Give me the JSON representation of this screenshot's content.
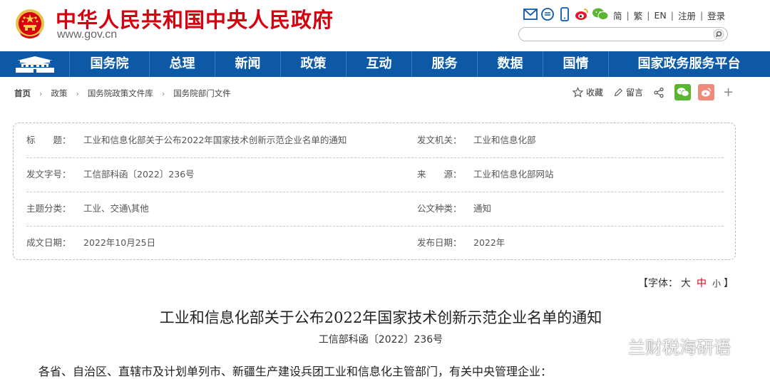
{
  "header": {
    "site_title": "中华人民共和国中央人民政府",
    "site_url": "www.gov.cn",
    "icons": [
      "mail-icon",
      "message-icon",
      "phone-icon",
      "weibo-icon",
      "wechat-icon"
    ],
    "links": [
      "简",
      "繁",
      "EN",
      "注册",
      "登录"
    ],
    "search": {
      "placeholder": "",
      "value": ""
    }
  },
  "nav": {
    "items": [
      "国务院",
      "总理",
      "新闻",
      "政策",
      "互动",
      "服务",
      "数据",
      "国情",
      "国家政务服务平台"
    ]
  },
  "breadcrumb": [
    "首页",
    "政策",
    "国务院政策文件库",
    "国务院部门文件"
  ],
  "tools": {
    "favorite": "收藏",
    "comment": "留言"
  },
  "info": {
    "title_label": "标　　题：",
    "title_value": "工业和信息化部关于公布2022年国家技术创新示范企业名单的通知",
    "issuer_label": "发文机关：",
    "issuer_value": "工业和信息化部",
    "docno_label": "发文字号：",
    "docno_value": "工信部科函〔2022〕236号",
    "source_label": "来　　源：",
    "source_value": "工业和信息化部网站",
    "topic_label": "主题分类：",
    "topic_value": "工业、交通\\其他",
    "doctype_label": "公文种类：",
    "doctype_value": "通知",
    "date_label": "成文日期：",
    "date_value": "2022年10月25日",
    "pubdate_label": "发布日期：",
    "pubdate_value": "2022年"
  },
  "fontsize": {
    "open": "【字体：",
    "large": "大",
    "medium": "中",
    "small": "小",
    "close": "】"
  },
  "article": {
    "title": "工业和信息化部关于公布2022年国家技术创新示范企业名单的通知",
    "doc_no": "工信部科函〔2022〕236号",
    "first_line": "各省、自治区、直辖市及计划单列市、新疆生产建设兵团工业和信息化主管部门，有关中央管理企业："
  },
  "watermark": "兰财税海研语",
  "colors": {
    "brand_red": "#d7000f",
    "nav_blue": "#0d59a6",
    "wechat_green": "#5cb531",
    "weibo_red": "#e6162d"
  }
}
